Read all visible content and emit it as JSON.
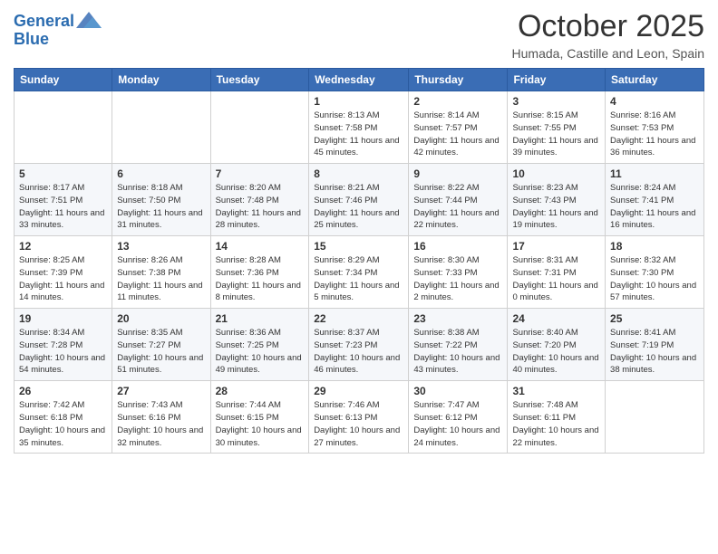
{
  "header": {
    "logo_line1": "General",
    "logo_line2": "Blue",
    "month_title": "October 2025",
    "location": "Humada, Castille and Leon, Spain"
  },
  "weekdays": [
    "Sunday",
    "Monday",
    "Tuesday",
    "Wednesday",
    "Thursday",
    "Friday",
    "Saturday"
  ],
  "weeks": [
    [
      {
        "day": "",
        "info": ""
      },
      {
        "day": "",
        "info": ""
      },
      {
        "day": "",
        "info": ""
      },
      {
        "day": "1",
        "info": "Sunrise: 8:13 AM\nSunset: 7:58 PM\nDaylight: 11 hours and 45 minutes."
      },
      {
        "day": "2",
        "info": "Sunrise: 8:14 AM\nSunset: 7:57 PM\nDaylight: 11 hours and 42 minutes."
      },
      {
        "day": "3",
        "info": "Sunrise: 8:15 AM\nSunset: 7:55 PM\nDaylight: 11 hours and 39 minutes."
      },
      {
        "day": "4",
        "info": "Sunrise: 8:16 AM\nSunset: 7:53 PM\nDaylight: 11 hours and 36 minutes."
      }
    ],
    [
      {
        "day": "5",
        "info": "Sunrise: 8:17 AM\nSunset: 7:51 PM\nDaylight: 11 hours and 33 minutes."
      },
      {
        "day": "6",
        "info": "Sunrise: 8:18 AM\nSunset: 7:50 PM\nDaylight: 11 hours and 31 minutes."
      },
      {
        "day": "7",
        "info": "Sunrise: 8:20 AM\nSunset: 7:48 PM\nDaylight: 11 hours and 28 minutes."
      },
      {
        "day": "8",
        "info": "Sunrise: 8:21 AM\nSunset: 7:46 PM\nDaylight: 11 hours and 25 minutes."
      },
      {
        "day": "9",
        "info": "Sunrise: 8:22 AM\nSunset: 7:44 PM\nDaylight: 11 hours and 22 minutes."
      },
      {
        "day": "10",
        "info": "Sunrise: 8:23 AM\nSunset: 7:43 PM\nDaylight: 11 hours and 19 minutes."
      },
      {
        "day": "11",
        "info": "Sunrise: 8:24 AM\nSunset: 7:41 PM\nDaylight: 11 hours and 16 minutes."
      }
    ],
    [
      {
        "day": "12",
        "info": "Sunrise: 8:25 AM\nSunset: 7:39 PM\nDaylight: 11 hours and 14 minutes."
      },
      {
        "day": "13",
        "info": "Sunrise: 8:26 AM\nSunset: 7:38 PM\nDaylight: 11 hours and 11 minutes."
      },
      {
        "day": "14",
        "info": "Sunrise: 8:28 AM\nSunset: 7:36 PM\nDaylight: 11 hours and 8 minutes."
      },
      {
        "day": "15",
        "info": "Sunrise: 8:29 AM\nSunset: 7:34 PM\nDaylight: 11 hours and 5 minutes."
      },
      {
        "day": "16",
        "info": "Sunrise: 8:30 AM\nSunset: 7:33 PM\nDaylight: 11 hours and 2 minutes."
      },
      {
        "day": "17",
        "info": "Sunrise: 8:31 AM\nSunset: 7:31 PM\nDaylight: 11 hours and 0 minutes."
      },
      {
        "day": "18",
        "info": "Sunrise: 8:32 AM\nSunset: 7:30 PM\nDaylight: 10 hours and 57 minutes."
      }
    ],
    [
      {
        "day": "19",
        "info": "Sunrise: 8:34 AM\nSunset: 7:28 PM\nDaylight: 10 hours and 54 minutes."
      },
      {
        "day": "20",
        "info": "Sunrise: 8:35 AM\nSunset: 7:27 PM\nDaylight: 10 hours and 51 minutes."
      },
      {
        "day": "21",
        "info": "Sunrise: 8:36 AM\nSunset: 7:25 PM\nDaylight: 10 hours and 49 minutes."
      },
      {
        "day": "22",
        "info": "Sunrise: 8:37 AM\nSunset: 7:23 PM\nDaylight: 10 hours and 46 minutes."
      },
      {
        "day": "23",
        "info": "Sunrise: 8:38 AM\nSunset: 7:22 PM\nDaylight: 10 hours and 43 minutes."
      },
      {
        "day": "24",
        "info": "Sunrise: 8:40 AM\nSunset: 7:20 PM\nDaylight: 10 hours and 40 minutes."
      },
      {
        "day": "25",
        "info": "Sunrise: 8:41 AM\nSunset: 7:19 PM\nDaylight: 10 hours and 38 minutes."
      }
    ],
    [
      {
        "day": "26",
        "info": "Sunrise: 7:42 AM\nSunset: 6:18 PM\nDaylight: 10 hours and 35 minutes."
      },
      {
        "day": "27",
        "info": "Sunrise: 7:43 AM\nSunset: 6:16 PM\nDaylight: 10 hours and 32 minutes."
      },
      {
        "day": "28",
        "info": "Sunrise: 7:44 AM\nSunset: 6:15 PM\nDaylight: 10 hours and 30 minutes."
      },
      {
        "day": "29",
        "info": "Sunrise: 7:46 AM\nSunset: 6:13 PM\nDaylight: 10 hours and 27 minutes."
      },
      {
        "day": "30",
        "info": "Sunrise: 7:47 AM\nSunset: 6:12 PM\nDaylight: 10 hours and 24 minutes."
      },
      {
        "day": "31",
        "info": "Sunrise: 7:48 AM\nSunset: 6:11 PM\nDaylight: 10 hours and 22 minutes."
      },
      {
        "day": "",
        "info": ""
      }
    ]
  ]
}
